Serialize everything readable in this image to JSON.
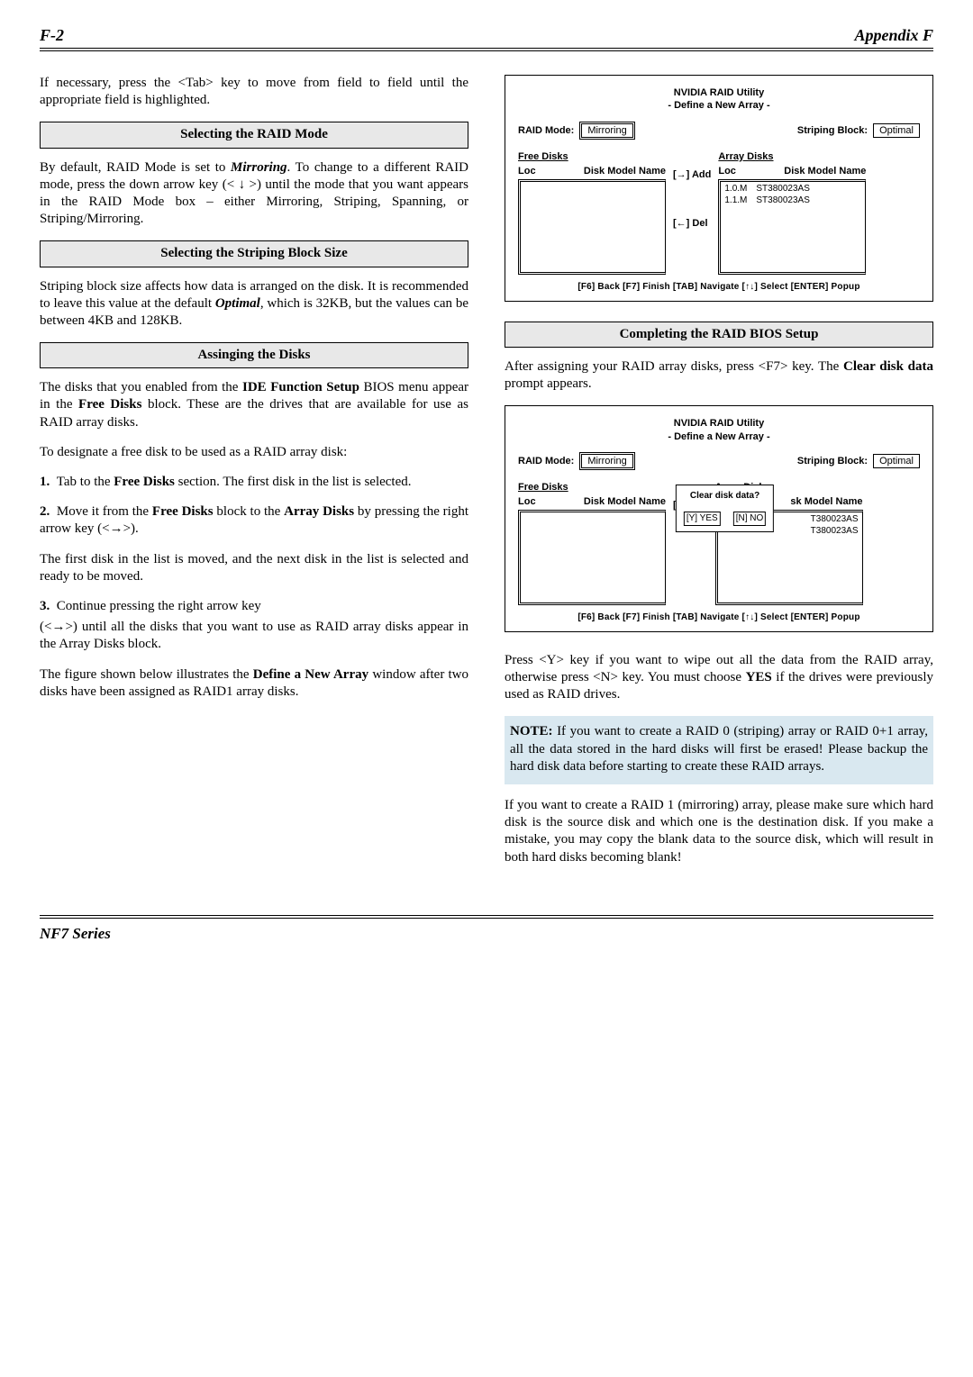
{
  "header": {
    "left": "F-2",
    "right": "Appendix F"
  },
  "footer": "NF7 Series",
  "left": {
    "p1": "If necessary, press the <Tab> key to move from field to field until the appropriate field is highlighted.",
    "sec1": "Selecting the RAID Mode",
    "p2_a": "By default, RAID Mode is set to ",
    "p2_b": "Mirroring",
    "p2_c": ". To change to a different RAID mode, press the down arrow key (< ↓ >) until the mode that you want appears in the RAID Mode box – either Mirroring, Striping, Spanning, or Striping/Mirroring.",
    "sec2": "Selecting the Striping Block Size",
    "p3_a": "Striping block size affects how data is arranged on the disk. It is recommended to leave this value at the default ",
    "p3_b": "Optimal",
    "p3_c": ", which is 32KB, but the values can be between 4KB and 128KB.",
    "sec3": "Assinging the Disks",
    "p4_a": "The disks that you enabled from the ",
    "p4_b": "IDE Function Setup",
    "p4_c": " BIOS menu appear in the ",
    "p4_d": "Free Disks",
    "p4_e": " block. These are the drives that are available for use as RAID array disks.",
    "p5": "To designate a free disk to be used as a RAID array disk:",
    "li1_a": "1.",
    "li1_b": "Tab to the ",
    "li1_c": "Free Disks",
    "li1_d": " section. The first disk in the list is selected.",
    "li2_a": "2.",
    "li2_b": "Move it from the ",
    "li2_c": "Free Disks",
    "li2_d": " block to the ",
    "li2_e": "Array Disks",
    "li2_f": " by pressing the right arrow key (<→>).",
    "p6": "The first disk in the list is moved, and the next disk in the list is selected and ready to be moved.",
    "li3_a": "3.",
    "li3_b": "Continue pressing the right arrow key",
    "p7": "(<→>) until all the disks that you want to use as RAID array disks appear in the Array Disks block.",
    "p8_a": "The figure shown below illustrates the ",
    "p8_b": "Define a New Array",
    "p8_c": " window after two disks have been assigned as RAID1 array disks."
  },
  "fig1": {
    "title1": "NVIDIA RAID Utility",
    "title2": "- Define a New Array -",
    "rm_label": "RAID Mode:",
    "rm_val": "Mirroring",
    "sb_label": "Striping Block:",
    "sb_val": "Optimal",
    "free_h": "Free Disks",
    "array_h": "Array Disks",
    "loc": "Loc",
    "dmn": "Disk Model Name",
    "add": "[→] Add",
    "del": "[←] Del",
    "row1_loc": "1.0.M",
    "row1_name": "ST380023AS",
    "row2_loc": "1.1.M",
    "row2_name": "ST380023AS",
    "foot": "[F6] Back   [F7] Finish   [TAB] Navigate   [↑↓] Select   [ENTER] Popup"
  },
  "right": {
    "sec4": "Completing the RAID BIOS Setup",
    "p9_a": "After assigning your RAID array disks, press <F7> key. The ",
    "p9_b": "Clear disk data",
    "p9_c": " prompt appears.",
    "p10_a": "Press <Y> key if you want to wipe out all the data from the RAID array, otherwise press <N> key. You must choose ",
    "p10_b": "YES",
    "p10_c": " if the drives were previously used as RAID drives.",
    "note_a": "NOTE:",
    "note_b": " If you want to create a RAID 0 (striping) array or RAID 0+1 array, all the data stored in the hard disks will first be erased! Please backup the hard disk data before starting to create these RAID arrays.",
    "p11": "If you want to create a RAID 1 (mirroring) array, please make sure which hard disk is the source disk and which one is the destination disk. If you make a mistake, you may copy the blank data to the source disk, which will result in both hard disks becoming blank!"
  },
  "fig2": {
    "popup_q": "Clear disk data?",
    "popup_y": "[Y] YES",
    "popup_n": "[N] NO",
    "dmn2": "sk Model Name",
    "d1": "T380023AS",
    "d2": "T380023AS"
  }
}
